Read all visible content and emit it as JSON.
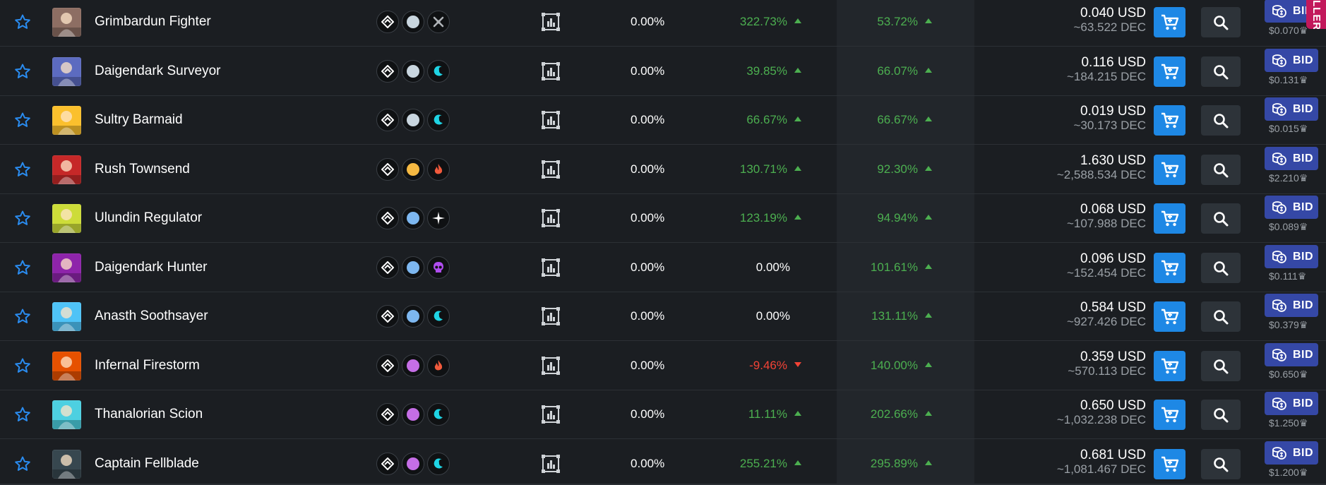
{
  "side_tab_label": "LLERS",
  "currency_suffix": "USD",
  "bid_label": "BID",
  "crown_glyph": "♛",
  "colors": {
    "background": "#1b1e22",
    "positive": "#4caf50",
    "negative": "#f44336",
    "cart_button": "#1e88e5",
    "bid_button": "#3548a6",
    "side_tab": "#c2185b"
  },
  "rows": [
    {
      "name": "Grimbardun Fighter",
      "rarity_color": "#c9d6df",
      "element": "neutral",
      "element_icon": "crossed-swords-icon",
      "avatar_bg": "#8d6e63",
      "change_1": "0.00%",
      "change_2": "322.73%",
      "change_2_dir": "up",
      "change_3": "53.72%",
      "change_3_dir": "up",
      "price_usd": "0.040 USD",
      "price_dec": "~63.522 DEC",
      "bid_price": "$0.070"
    },
    {
      "name": "Daigendark Surveyor",
      "rarity_color": "#c9d6df",
      "element": "water",
      "element_icon": "water-wave-icon",
      "avatar_bg": "#5c6bc0",
      "change_1": "0.00%",
      "change_2": "39.85%",
      "change_2_dir": "up",
      "change_3": "66.07%",
      "change_3_dir": "up",
      "price_usd": "0.116 USD",
      "price_dec": "~184.215 DEC",
      "bid_price": "$0.131"
    },
    {
      "name": "Sultry Barmaid",
      "rarity_color": "#c9d6df",
      "element": "water",
      "element_icon": "water-wave-icon",
      "avatar_bg": "#fbc02d",
      "change_1": "0.00%",
      "change_2": "66.67%",
      "change_2_dir": "up",
      "change_3": "66.67%",
      "change_3_dir": "up",
      "price_usd": "0.019 USD",
      "price_dec": "~30.173 DEC",
      "bid_price": "$0.015"
    },
    {
      "name": "Rush Townsend",
      "rarity_color": "#f5b942",
      "element": "fire",
      "element_icon": "fire-icon",
      "avatar_bg": "#c62828",
      "change_1": "0.00%",
      "change_2": "130.71%",
      "change_2_dir": "up",
      "change_3": "92.30%",
      "change_3_dir": "up",
      "price_usd": "1.630 USD",
      "price_dec": "~2,588.534 DEC",
      "bid_price": "$2.210"
    },
    {
      "name": "Ulundin Regulator",
      "rarity_color": "#7db7f0",
      "element": "life",
      "element_icon": "sparkle-icon",
      "avatar_bg": "#cddc39",
      "change_1": "0.00%",
      "change_2": "123.19%",
      "change_2_dir": "up",
      "change_3": "94.94%",
      "change_3_dir": "up",
      "price_usd": "0.068 USD",
      "price_dec": "~107.988 DEC",
      "bid_price": "$0.089"
    },
    {
      "name": "Daigendark Hunter",
      "rarity_color": "#7db7f0",
      "element": "death",
      "element_icon": "skull-icon",
      "avatar_bg": "#8e24aa",
      "change_1": "0.00%",
      "change_2": "0.00%",
      "change_2_dir": "flat",
      "change_3": "101.61%",
      "change_3_dir": "up",
      "price_usd": "0.096 USD",
      "price_dec": "~152.454 DEC",
      "bid_price": "$0.111"
    },
    {
      "name": "Anasth Soothsayer",
      "rarity_color": "#7db7f0",
      "element": "water",
      "element_icon": "water-wave-icon",
      "avatar_bg": "#4fc3f7",
      "change_1": "0.00%",
      "change_2": "0.00%",
      "change_2_dir": "flat",
      "change_3": "131.11%",
      "change_3_dir": "up",
      "price_usd": "0.584 USD",
      "price_dec": "~927.426 DEC",
      "bid_price": "$0.379"
    },
    {
      "name": "Infernal Firestorm",
      "rarity_color": "#c56ee6",
      "element": "fire",
      "element_icon": "fire-icon",
      "avatar_bg": "#e65100",
      "change_1": "0.00%",
      "change_2": "-9.46%",
      "change_2_dir": "down",
      "change_3": "140.00%",
      "change_3_dir": "up",
      "price_usd": "0.359 USD",
      "price_dec": "~570.113 DEC",
      "bid_price": "$0.650"
    },
    {
      "name": "Thanalorian Scion",
      "rarity_color": "#c56ee6",
      "element": "water",
      "element_icon": "water-wave-icon",
      "avatar_bg": "#4dd0e1",
      "change_1": "0.00%",
      "change_2": "11.11%",
      "change_2_dir": "up",
      "change_3": "202.66%",
      "change_3_dir": "up",
      "price_usd": "0.650 USD",
      "price_dec": "~1,032.238 DEC",
      "bid_price": "$1.250"
    },
    {
      "name": "Captain Fellblade",
      "rarity_color": "#c56ee6",
      "element": "water",
      "element_icon": "water-wave-icon",
      "avatar_bg": "#37474f",
      "change_1": "0.00%",
      "change_2": "255.21%",
      "change_2_dir": "up",
      "change_3": "295.89%",
      "change_3_dir": "up",
      "price_usd": "0.681 USD",
      "price_dec": "~1,081.467 DEC",
      "bid_price": "$1.200"
    }
  ]
}
